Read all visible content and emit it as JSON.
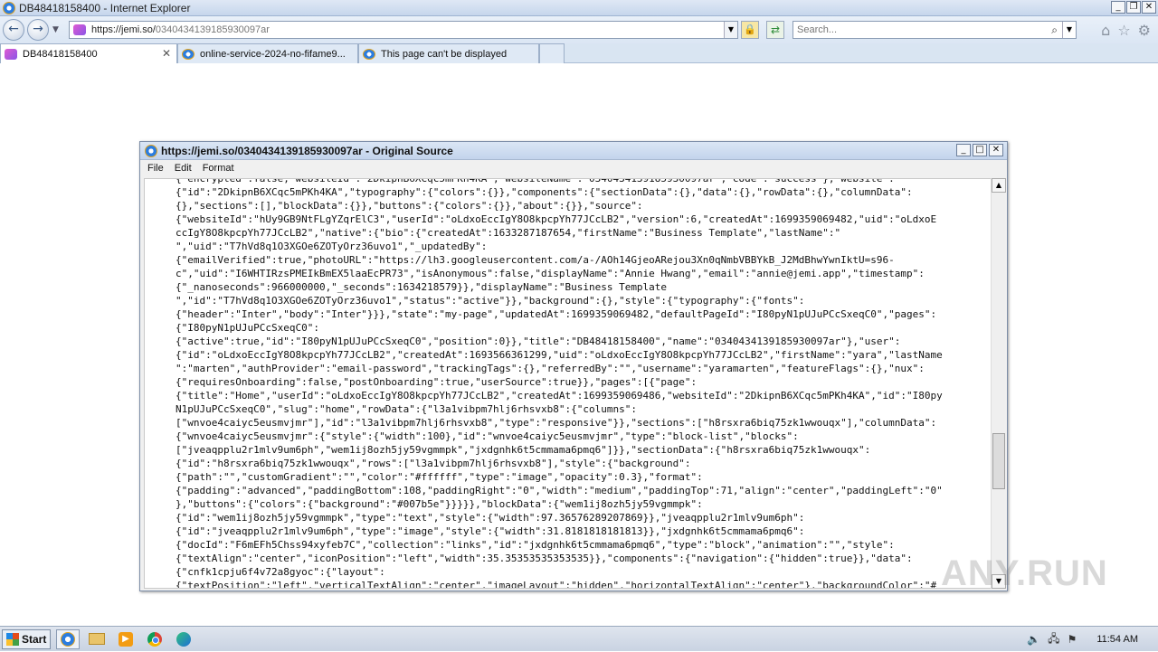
{
  "browser": {
    "window_title": "DB48418158400 - Internet Explorer",
    "address": {
      "host": "https://jemi.so/",
      "path": "0340434139185930097ar"
    },
    "search_placeholder": "Search..."
  },
  "tabs": [
    {
      "label": "DB48418158400",
      "active": true
    },
    {
      "label": "online-service-2024-no-fifame9...",
      "active": false
    },
    {
      "label": "This page can't be displayed",
      "active": false
    }
  ],
  "source_window": {
    "title": "https://jemi.so/0340434139185930097ar - Original Source",
    "menu": [
      "File",
      "Edit",
      "Format"
    ],
    "lines": [
      "{\"encrypted\":false,\"websiteId\":\"2DkipnB6XCqc5mPKh4KA\",\"websiteName\":\"0340434139185930097ar\",\"code\":\"success\"},\"website\":",
      "{\"id\":\"2DkipnB6XCqc5mPKh4KA\",\"typography\":{\"colors\":{}},\"components\":{\"sectionData\":{},\"data\":{},\"rowData\":{},\"columnData\":",
      "{},\"sections\":[],\"blockData\":{}},\"buttons\":{\"colors\":{}},\"about\":{}},\"source\":",
      "{\"websiteId\":\"hUy9GB9NtFLgYZqrElC3\",\"userId\":\"oLdxoEccIgY8O8kpcpYh77JCcLB2\",\"version\":6,\"createdAt\":1699359069482,\"uid\":\"oLdxoE",
      "ccIgY8O8kpcpYh77JCcLB2\",\"native\":{\"bio\":{\"createdAt\":1633287187654,\"firstName\":\"Business Template\",\"lastName\":\"",
      "\",\"uid\":\"T7hVd8q1O3XGOe6ZOTyOrz36uvo1\",\"_updatedBy\":",
      "{\"emailVerified\":true,\"photoURL\":\"https://lh3.googleusercontent.com/a-/AOh14GjeoARejou3Xn0qNmbVBBYkB_J2MdBhwYwnIktU=s96-",
      "c\",\"uid\":\"I6WHTIRzsPMEIkBmEX5laaEcPR73\",\"isAnonymous\":false,\"displayName\":\"Annie Hwang\",\"email\":\"annie@jemi.app\",\"timestamp\":",
      "{\"_nanoseconds\":966000000,\"_seconds\":1634218579}},\"displayName\":\"Business Template",
      "\",\"id\":\"T7hVd8q1O3XGOe6ZOTyOrz36uvo1\",\"status\":\"active\"}},\"background\":{},\"style\":{\"typography\":{\"fonts\":",
      "{\"header\":\"Inter\",\"body\":\"Inter\"}}},\"state\":\"my-page\",\"updatedAt\":1699359069482,\"defaultPageId\":\"I80pyN1pUJuPCcSxeqC0\",\"pages\":",
      "{\"I80pyN1pUJuPCcSxeqC0\":",
      "{\"active\":true,\"id\":\"I80pyN1pUJuPCcSxeqC0\",\"position\":0}},\"title\":\"DB48418158400\",\"name\":\"0340434139185930097ar\"},\"user\":",
      "{\"id\":\"oLdxoEccIgY8O8kpcpYh77JCcLB2\",\"createdAt\":1693566361299,\"uid\":\"oLdxoEccIgY8O8kpcpYh77JCcLB2\",\"firstName\":\"yara\",\"lastName",
      "\":\"marten\",\"authProvider\":\"email-password\",\"trackingTags\":{},\"referredBy\":\"\",\"username\":\"yaramarten\",\"featureFlags\":{},\"nux\":",
      "{\"requiresOnboarding\":false,\"postOnboarding\":true,\"userSource\":true}},\"pages\":[{\"page\":",
      "{\"title\":\"Home\",\"userId\":\"oLdxoEccIgY8O8kpcpYh77JCcLB2\",\"createdAt\":1699359069486,\"websiteId\":\"2DkipnB6XCqc5mPKh4KA\",\"id\":\"I80py",
      "N1pUJuPCcSxeqC0\",\"slug\":\"home\",\"rowData\":{\"l3a1vibpm7hlj6rhsvxb8\":{\"columns\":",
      "[\"wnvoe4caiyc5eusmvjmr\"],\"id\":\"l3a1vibpm7hlj6rhsvxb8\",\"type\":\"responsive\"}},\"sections\":[\"h8rsxra6biq75zk1wwouqx\"],\"columnData\":",
      "{\"wnvoe4caiyc5eusmvjmr\":{\"style\":{\"width\":100},\"id\":\"wnvoe4caiyc5eusmvjmr\",\"type\":\"block-list\",\"blocks\":",
      "[\"jveaqpplu2r1mlv9um6ph\",\"wem1ij8ozh5jy59vgmmpk\",\"jxdgnhk6t5cmmama6pmq6\"]}},\"sectionData\":{\"h8rsxra6biq75zk1wwouqx\":",
      "{\"id\":\"h8rsxra6biq75zk1wwouqx\",\"rows\":[\"l3a1vibpm7hlj6rhsvxb8\"],\"style\":{\"background\":",
      "{\"path\":\"\",\"customGradient\":\"\",\"color\":\"#ffffff\",\"type\":\"image\",\"opacity\":0.3},\"format\":",
      "{\"padding\":\"advanced\",\"paddingBottom\":108,\"paddingRight\":\"0\",\"width\":\"medium\",\"paddingTop\":71,\"align\":\"center\",\"paddingLeft\":\"0\"",
      "},\"buttons\":{\"colors\":{\"background\":\"#007b5e\"}}}}},\"blockData\":{\"wem1ij8ozh5jy59vgmmpk\":",
      "{\"id\":\"wem1ij8ozh5jy59vgmmpk\",\"type\":\"text\",\"style\":{\"width\":97.36576289207869}},\"jveaqpplu2r1mlv9um6ph\":",
      "{\"id\":\"jveaqpplu2r1mlv9um6ph\",\"type\":\"image\",\"style\":{\"width\":31.8181818181813}},\"jxdgnhk6t5cmmama6pmq6\":",
      "{\"docId\":\"F6mEFh5Chss94xyfeb7C\",\"collection\":\"links\",\"id\":\"jxdgnhk6t5cmmama6pmq6\",\"type\":\"block\",\"animation\":\"\",\"style\":",
      "{\"textAlign\":\"center\",\"iconPosition\":\"left\",\"width\":35.35353535353535}},\"components\":{\"navigation\":{\"hidden\":true}},\"data\":",
      "{\"cnfk1cpju6f4v72a8gyoc\":{\"layout\":",
      "{\"textPosition\":\"left\",\"verticalTextAlign\":\"center\",\"imageLayout\":\"hidden\",\"horizontalTextAlign\":\"center\"},\"backgroundColor\":\"#"
    ]
  },
  "watermark": "ANY.RUN",
  "taskbar": {
    "start_label": "Start",
    "clock": "11:54 AM"
  },
  "icons": {
    "back": "back-arrow-icon",
    "forward": "forward-arrow-icon",
    "lock": "lock-icon",
    "refresh": "refresh-icon",
    "search": "search-icon",
    "home": "home-icon",
    "favorites": "star-icon",
    "settings": "gear-icon"
  }
}
